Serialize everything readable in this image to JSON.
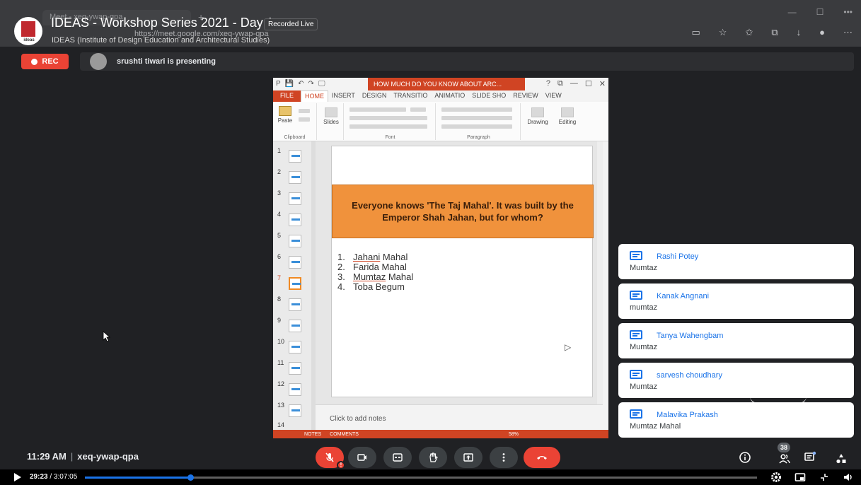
{
  "browser": {
    "tab_title": "Meet - xeq-ywap-qpa",
    "new_tab": "+",
    "url": "https://meet.google.com/xeq-ywap-qpa"
  },
  "video": {
    "title": "IDEAS - Workshop Series 2021 - Day 1",
    "badge": "Recorded Live",
    "channel": "IDEAS (Institute of Design Education and Architectural Studies)",
    "logo_text": "ideas"
  },
  "meet": {
    "rec_label": "REC",
    "presenting_text": "srushti tiwari is presenting",
    "time": "11:29 AM",
    "separator": "|",
    "meeting_code": "xeq-ywap-qpa",
    "participant_count": "38"
  },
  "ppt": {
    "quick_access": [
      "P",
      "💾",
      "↶",
      "↷",
      "🖵"
    ],
    "doc_title": "HOW MUCH DO YOU KNOW ABOUT ARC...",
    "window_buttons": [
      "?",
      "⧉",
      "—",
      "☐",
      "✕"
    ],
    "tabs": [
      "FILE",
      "HOME",
      "INSERT",
      "DESIGN",
      "TRANSITIO",
      "ANIMATIO",
      "SLIDE SHO",
      "REVIEW",
      "VIEW"
    ],
    "ribbon": {
      "paste": "Paste",
      "slides": "Slides",
      "drawing": "Drawing",
      "editing": "Editing",
      "groups": [
        "Clipboard",
        "Font",
        "Paragraph"
      ]
    },
    "thumb_numbers": [
      "1",
      "2",
      "3",
      "4",
      "5",
      "6",
      "7",
      "8",
      "9",
      "10",
      "11",
      "12",
      "13",
      "14"
    ],
    "slide_question": "Everyone knows 'The Taj Mahal'. It was built by the Emperor Shah Jahan, but for whom?",
    "options": [
      {
        "num": "1.",
        "underlined": "Jahani",
        "rest": " Mahal"
      },
      {
        "num": "2.",
        "underlined": "",
        "rest": "Farida Mahal"
      },
      {
        "num": "3.",
        "underlined": "Mumtaz",
        "rest": " Mahal"
      },
      {
        "num": "4.",
        "underlined": "",
        "rest": "Toba Begum"
      }
    ],
    "notes_placeholder": "Click to add notes",
    "status": [
      "NOTES",
      "COMMENTS",
      "58%"
    ]
  },
  "chat": [
    {
      "name": "Rashi Potey",
      "message": "Mumtaz"
    },
    {
      "name": "Kanak Angnani",
      "message": "mumtaz"
    },
    {
      "name": "Tanya Wahengbam",
      "message": "Mumtaz"
    },
    {
      "name": "sarvesh choudhary",
      "message": "Mumtaz"
    },
    {
      "name": "Malavika Prakash",
      "message": "Mumtaz Mahal"
    }
  ],
  "player": {
    "current_time": "29:23",
    "duration": "/ 3:07:05",
    "progress_fraction": 0.157
  },
  "colors": {
    "meet_red": "#ea4335",
    "meet_blue": "#1a73e8",
    "ppt_orange": "#d04423",
    "slide_banner": "#f0923c"
  }
}
